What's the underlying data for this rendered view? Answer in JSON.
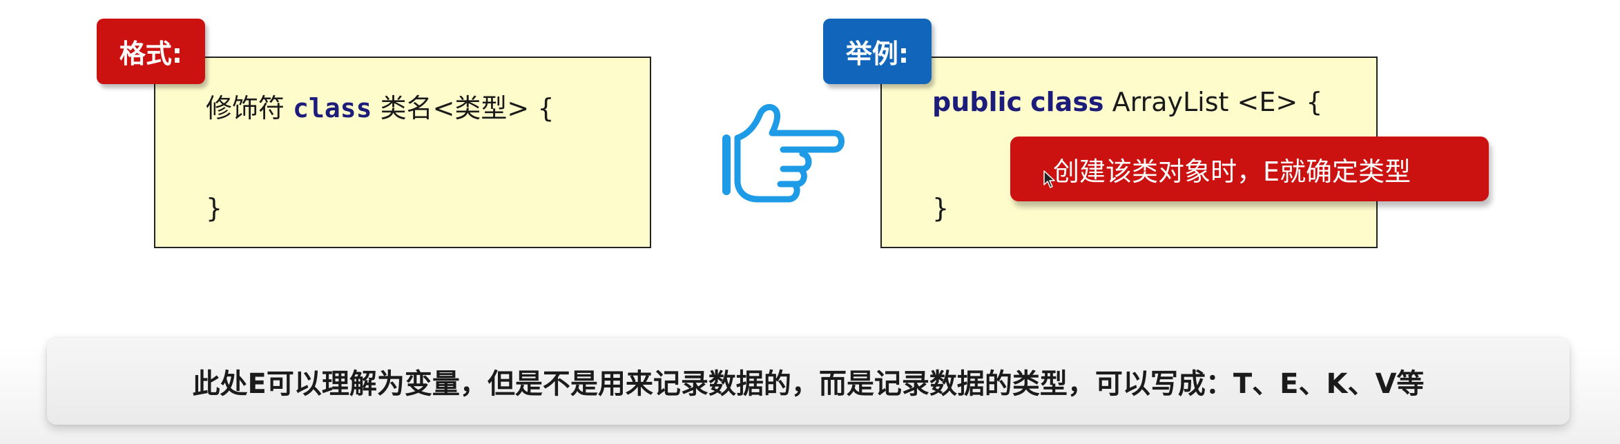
{
  "format": {
    "label": "格式:",
    "line1_prefix": "修饰符",
    "line1_keyword": "class",
    "line1_suffix": "类名<类型> {",
    "closing_brace": "}"
  },
  "example": {
    "label": "举例:",
    "keyword_public": "public",
    "keyword_class": "class",
    "line1_suffix": "ArrayList <E> {",
    "closing_brace": "}"
  },
  "callout": {
    "text": "创建该类对象时，E就确定类型"
  },
  "note": {
    "text": "此处E可以理解为变量，但是不是用来记录数据的，而是记录数据的类型，可以写成：T、E、K、V等"
  },
  "colors": {
    "tag_red": "#cc1111",
    "tag_blue": "#1166bb",
    "code_bg": "#fffccc",
    "keyword": "#1c1c7a",
    "hand_icon": "#1e9be6"
  },
  "icons": {
    "pointing_hand": "pointing-hand-icon",
    "cursor": "mouse-cursor-icon"
  }
}
